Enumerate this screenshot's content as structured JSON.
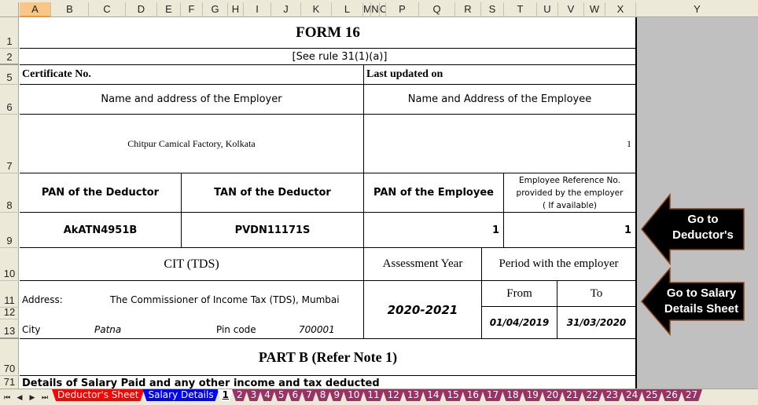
{
  "columns": [
    "A",
    "B",
    "C",
    "D",
    "E",
    "F",
    "G",
    "H",
    "I",
    "J",
    "K",
    "L",
    "M",
    "N",
    "O",
    "P",
    "Q",
    "R",
    "S",
    "T",
    "U",
    "V",
    "W",
    "X",
    "Y"
  ],
  "active_column": "A",
  "rows": [
    "1",
    "2",
    "5",
    "6",
    "7",
    "8",
    "9",
    "10",
    "11",
    "12",
    "13",
    "70",
    "71"
  ],
  "form": {
    "title": "FORM 16",
    "rule": "[See rule 31(1)(a)]",
    "certificate_no_label": "Certificate No.",
    "last_updated_label": "Last updated on",
    "employer_name_label": "Name and address of the Employer",
    "employee_name_label": "Name and Address of the Employee",
    "employer_name_value": "Chitpur Camical Factory, Kolkata",
    "employee_name_value": "1",
    "pan_deductor_label": "PAN of the Deductor",
    "tan_deductor_label": "TAN of the Deductor",
    "pan_employee_label": "PAN of the Employee",
    "employee_ref_label_1": "Employee Reference No.",
    "employee_ref_label_2": "provided by the employer",
    "employee_ref_label_3": "( If available)",
    "pan_deductor_value": "AkATN4951B",
    "tan_deductor_value": "PVDN11171S",
    "pan_employee_value": "1",
    "employee_ref_value": "1",
    "cit_label": "CIT (TDS)",
    "assessment_year_label": "Assessment Year",
    "period_label": "Period with the employer",
    "address_label": "Address:",
    "address_value": "The Commissioner of Income Tax (TDS), Mumbai",
    "city_label": "City",
    "city_value": "Patna",
    "pin_label": "Pin code",
    "pin_value": "700001",
    "assessment_year_value": "2020-2021",
    "from_label": "From",
    "to_label": "To",
    "from_value": "01/04/2019",
    "to_value": "31/03/2020",
    "part_b_title": "PART B (Refer Note 1)",
    "details_label": "Details of Salary Paid and any other income and tax deducted"
  },
  "buttons": {
    "go_to_deductor_line1": "Go to",
    "go_to_deductor_line2": "Deductor's",
    "go_to_salary_line1": "Go to Salary",
    "go_to_salary_line2": "Details Sheet"
  },
  "tab_nav": {
    "first": "⏮",
    "prev": "◀",
    "next": "▶",
    "last": "⏭"
  },
  "sheet_tabs": [
    {
      "label": "Deductor's Sheet",
      "color": "#ff0000"
    },
    {
      "label": "Salary Details",
      "color": "#0000ff"
    },
    {
      "label": "1",
      "active": true
    },
    {
      "label": "2"
    },
    {
      "label": "3"
    },
    {
      "label": "4"
    },
    {
      "label": "5"
    },
    {
      "label": "6"
    },
    {
      "label": "7"
    },
    {
      "label": "8"
    },
    {
      "label": "9"
    },
    {
      "label": "10"
    },
    {
      "label": "11"
    },
    {
      "label": "12"
    },
    {
      "label": "13"
    },
    {
      "label": "14"
    },
    {
      "label": "15"
    },
    {
      "label": "16"
    },
    {
      "label": "17"
    },
    {
      "label": "18"
    },
    {
      "label": "19"
    },
    {
      "label": "20"
    },
    {
      "label": "21"
    },
    {
      "label": "22"
    },
    {
      "label": "23"
    },
    {
      "label": "24"
    },
    {
      "label": "25"
    },
    {
      "label": "26"
    },
    {
      "label": "27"
    }
  ],
  "colors": {
    "numbered_tab": "#993366",
    "gray_area": "#c0c0c0",
    "header_bg": "#ece9d8"
  }
}
